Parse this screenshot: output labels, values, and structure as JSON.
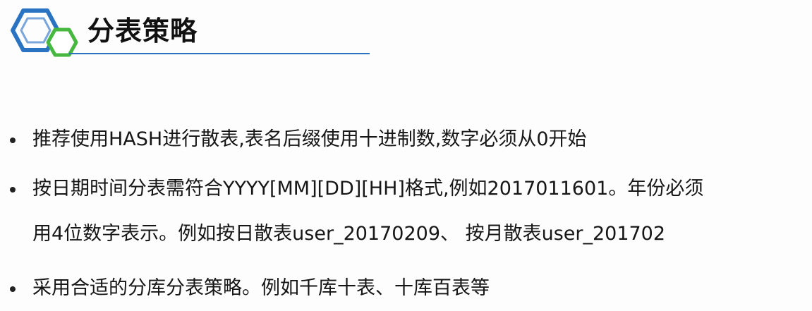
{
  "slide": {
    "title": "分表策略",
    "logo_icon": "hexagon-logo-icon",
    "accent_color": "#2a73c3",
    "logo_green": "#46b83f",
    "bullets": [
      {
        "lines": [
          "推荐使用HASH进行散表,表名后缀使用十进制数,数字必须从0开始"
        ]
      },
      {
        "lines": [
          "按日期时间分表需符合YYYY[MM][DD][HH]格式,例如2017011601。年份必须",
          "用4位数字表示。例如按日散表user_20170209、 按月散表user_201702"
        ]
      },
      {
        "lines": [
          "采用合适的分库分表策略。例如千库十表、十库百表等"
        ]
      }
    ]
  }
}
